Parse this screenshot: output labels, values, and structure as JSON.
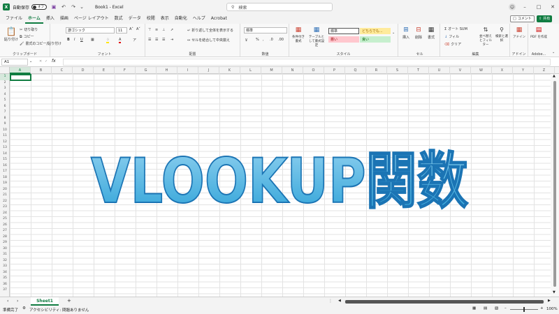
{
  "titlebar": {
    "autosave_label": "自動保存",
    "autosave_state": "オフ",
    "doc_title": "Book1 - Excel",
    "search_placeholder": "検索"
  },
  "menu": {
    "tabs": [
      "ファイル",
      "ホーム",
      "挿入",
      "描画",
      "ページ レイアウト",
      "数式",
      "データ",
      "校閲",
      "表示",
      "自動化",
      "ヘルプ",
      "Acrobat"
    ],
    "active_index": 1,
    "comment_label": "コメント",
    "share_label": "共有"
  },
  "ribbon": {
    "clipboard": {
      "paste": "貼り付け",
      "cut": "切り取り",
      "copy": "コピー",
      "format_painter": "書式のコピー/貼り付け",
      "group": "クリップボード"
    },
    "font": {
      "name": "游ゴシック",
      "size": "11",
      "group": "フォント"
    },
    "alignment": {
      "wrap": "折り返して全体を表示する",
      "merge": "セルを結合して中央揃え",
      "group": "配置"
    },
    "number": {
      "format": "標準",
      "group": "数値"
    },
    "styles": {
      "conditional": "条件付き書式",
      "table": "テーブルとして書式設定",
      "standard": "標準",
      "neutral": "どちらでも...",
      "bad": "悪い",
      "good": "良い",
      "group": "スタイル"
    },
    "cells": {
      "insert": "挿入",
      "delete": "削除",
      "format": "書式",
      "group": "セル"
    },
    "editing": {
      "autosum": "オート SUM",
      "fill": "フィル",
      "clear": "クリア",
      "sort": "並べ替えとフィルター",
      "find": "検索と選択",
      "group": "編集"
    },
    "addins": {
      "label": "アドイン",
      "group": "アドイン"
    },
    "adobe": {
      "label": "PDF を作成",
      "group": "Adobe..."
    }
  },
  "formula_bar": {
    "name_box": "A1",
    "fx": "fx",
    "value": ""
  },
  "columns": [
    "A",
    "B",
    "C",
    "D",
    "E",
    "F",
    "G",
    "H",
    "I",
    "J",
    "K",
    "L",
    "M",
    "N",
    "O",
    "P",
    "Q",
    "R",
    "S",
    "T",
    "U",
    "V",
    "W",
    "X",
    "Y",
    "Z"
  ],
  "rows": [
    "1",
    "2",
    "3",
    "4",
    "5",
    "6",
    "7",
    "8",
    "9",
    "10",
    "11",
    "12",
    "13",
    "14",
    "15",
    "16",
    "17",
    "18",
    "19",
    "20",
    "21",
    "22",
    "23",
    "24",
    "25",
    "26",
    "27",
    "28",
    "29",
    "30",
    "31",
    "32",
    "33",
    "34",
    "35",
    "36",
    "37"
  ],
  "sheets": {
    "active": "Sheet1",
    "add": "+"
  },
  "status": {
    "ready": "準備完了",
    "accessibility": "アクセシビリティ: 問題ありません",
    "zoom": "100%"
  },
  "overlay_title": "VLOOKUP関数",
  "colors": {
    "accent": "#107c41",
    "title_fill_top": "#8fd0ef",
    "title_fill_bottom": "#2fa3d8",
    "title_stroke": "#1b74b4"
  }
}
